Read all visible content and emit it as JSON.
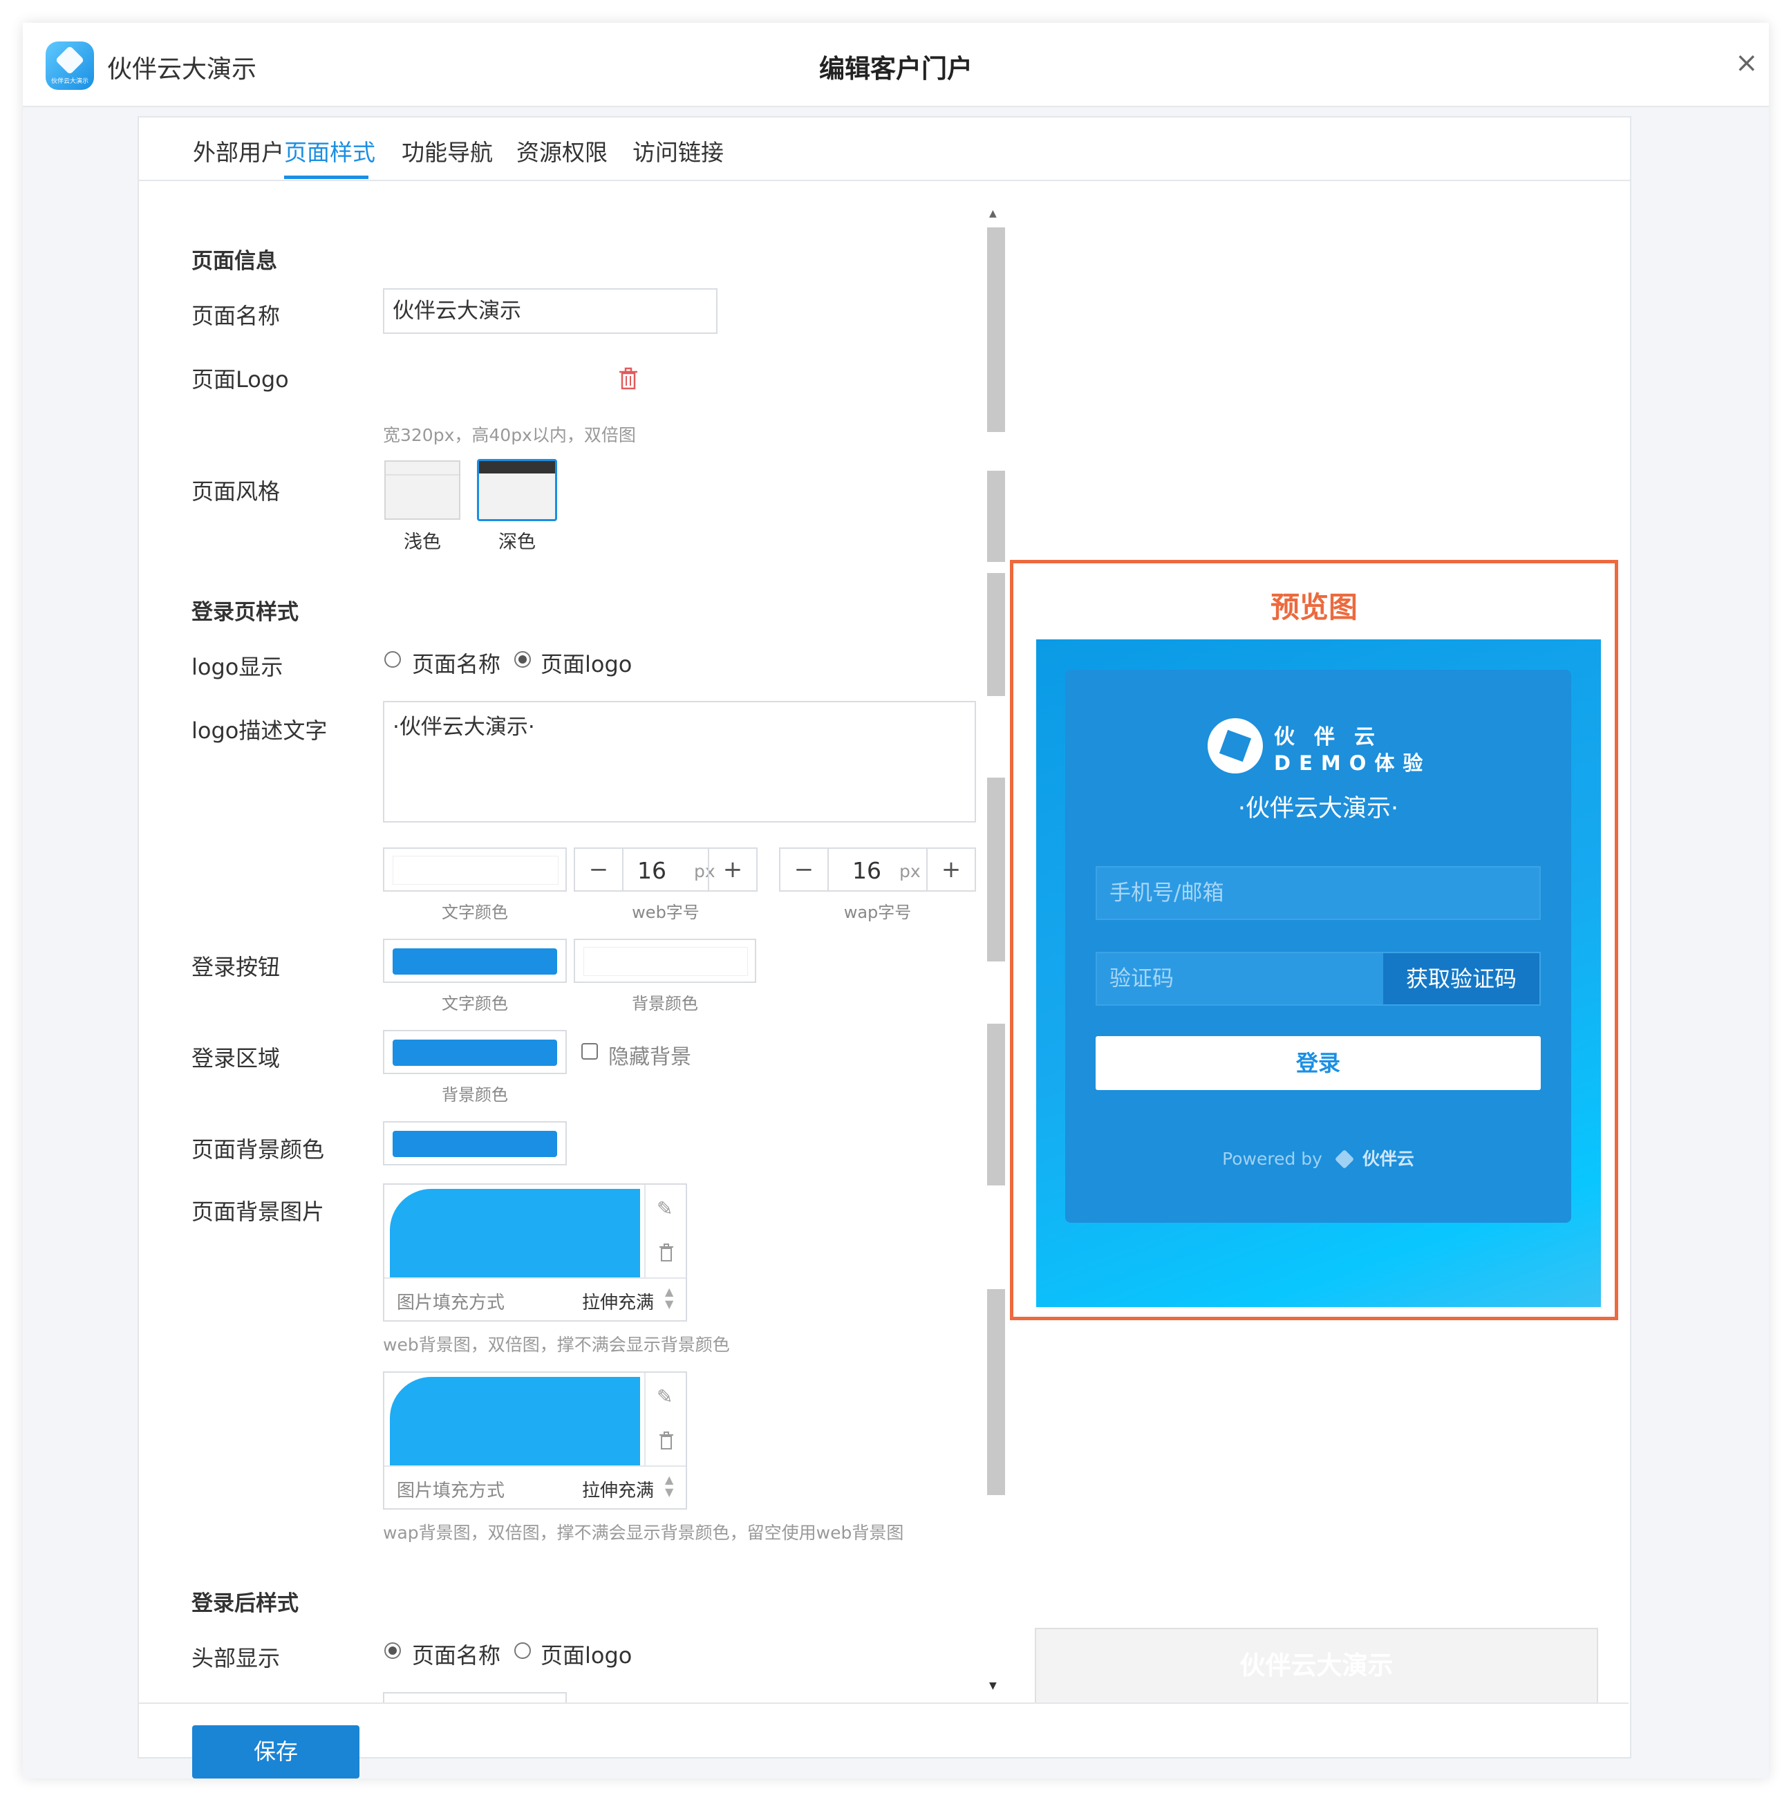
{
  "app": {
    "name": "伙伴云大演示",
    "logo_sub": "伙伴云大演示"
  },
  "dialog": {
    "title": "编辑客户门户",
    "close": "×"
  },
  "tabs": [
    "外部用户",
    "页面样式",
    "功能导航",
    "资源权限",
    "访问链接"
  ],
  "active_tab": "页面样式",
  "page_info": {
    "section": "页面信息",
    "name_label": "页面名称",
    "name_value": "伙伴云大演示",
    "logo_label": "页面Logo",
    "logo_hint": "宽320px，高40px以内，双倍图",
    "style_label": "页面风格",
    "style_light": "浅色",
    "style_dark": "深色"
  },
  "login_style": {
    "section": "登录页样式",
    "logo_display_label": "logo显示",
    "opt_name": "页面名称",
    "opt_logo": "页面logo",
    "desc_label": "logo描述文字",
    "desc_value": "·伙伴云大演示·",
    "text_color_cap": "文字颜色",
    "web_size": "16",
    "web_size_cap": "web字号",
    "wap_size": "16",
    "wap_size_cap": "wap字号",
    "unit": "px",
    "button_label": "登录按钮",
    "btn_text_color_cap": "文字颜色",
    "btn_bg_color_cap": "背景颜色",
    "area_label": "登录区域",
    "area_bg_cap": "背景颜色",
    "hide_bg": "隐藏背景",
    "page_bg_color_label": "页面背景颜色",
    "page_bg_img_label": "页面背景图片",
    "fill_label": "图片填充方式",
    "fill_value": "拉伸充满",
    "web_bg_hint": "web背景图，双倍图，撑不满会显示背景颜色",
    "wap_bg_hint": "wap背景图，双倍图，撑不满会显示背景颜色，留空使用web背景图"
  },
  "after_login": {
    "section": "登录后样式",
    "header_label": "头部显示",
    "opt_name": "页面名称",
    "opt_logo": "页面logo"
  },
  "preview": {
    "title": "预览图",
    "brand_line1": "伙伴云",
    "brand_line2": "DEMO体验",
    "desc": "·伙伴云大演示·",
    "phone_placeholder": "手机号/邮箱",
    "code_placeholder": "验证码",
    "get_code": "获取验证码",
    "login": "登录",
    "powered": "Powered by",
    "powered_brand": "伙伴云",
    "bottom_title": "伙伴云大演示"
  },
  "save": "保存",
  "colors": {
    "accent": "#1a8fe3",
    "preview_border": "#ec6a3e",
    "login_card": "#1d8fdb"
  }
}
